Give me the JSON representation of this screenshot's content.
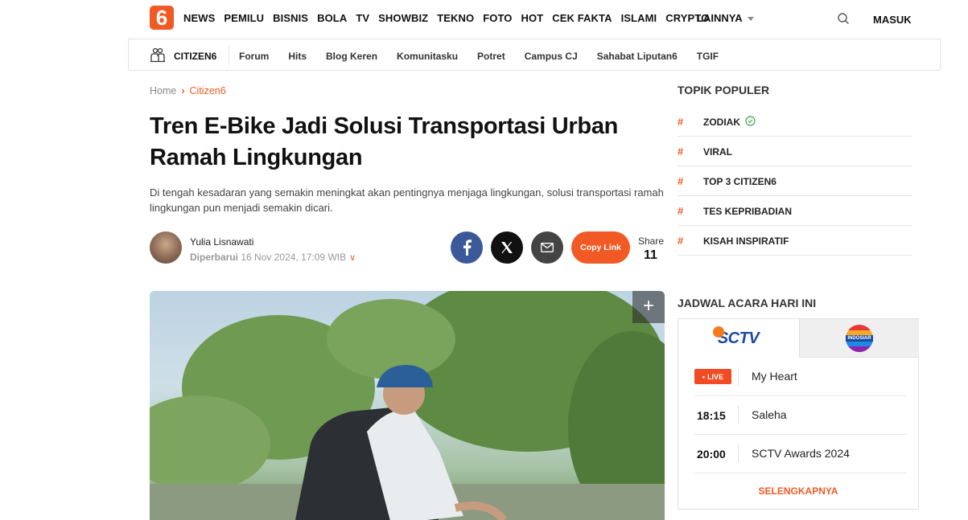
{
  "logo": {
    "text": "6"
  },
  "nav": {
    "items": [
      "NEWS",
      "PEMILU",
      "BISNIS",
      "BOLA",
      "TV",
      "SHOWBIZ",
      "TEKNO",
      "FOTO",
      "HOT",
      "CEK FAKTA",
      "ISLAMI",
      "CRYPTO"
    ],
    "more": "LAINNYA",
    "login": "MASUK"
  },
  "subnav": {
    "section": "CITIZEN6",
    "items": [
      "Forum",
      "Hits",
      "Blog Keren",
      "Komunitasku",
      "Potret",
      "Campus CJ",
      "Sahabat Liputan6",
      "TGIF"
    ]
  },
  "breadcrumb": {
    "home": "Home",
    "current": "Citizen6"
  },
  "article": {
    "title": "Tren E-Bike Jadi Solusi Transportasi Urban Ramah Lingkungan",
    "lead": "Di tengah kesadaran yang semakin meningkat akan pentingnya menjaga lingkungan, solusi transportasi ramah lingkungan pun menjadi semakin dicari.",
    "author": "Yulia Lisnawati",
    "updated_label": "Diperbarui",
    "updated_date": "16 Nov 2024, 17:09 WIB"
  },
  "share": {
    "copy_label": "Copy Link",
    "label": "Share",
    "count": "11"
  },
  "topik": {
    "title": "TOPIK POPULER",
    "items": [
      "ZODIAK",
      "VIRAL",
      "TOP 3 CITIZEN6",
      "TES KEPRIBADIAN",
      "KISAH INSPIRATIF"
    ]
  },
  "jadwal": {
    "title": "JADWAL ACARA HARI INI",
    "channels": [
      "SCTV",
      "INDOSIAR"
    ],
    "live_label": "LIVE",
    "items": [
      {
        "time": "",
        "program": "My Heart"
      },
      {
        "time": "18:15",
        "program": "Saleha"
      },
      {
        "time": "20:00",
        "program": "SCTV Awards 2024"
      }
    ],
    "more": "SELENGKAPNYA"
  },
  "colors": {
    "brand": "#f15a24",
    "facebook": "#3b5998"
  }
}
